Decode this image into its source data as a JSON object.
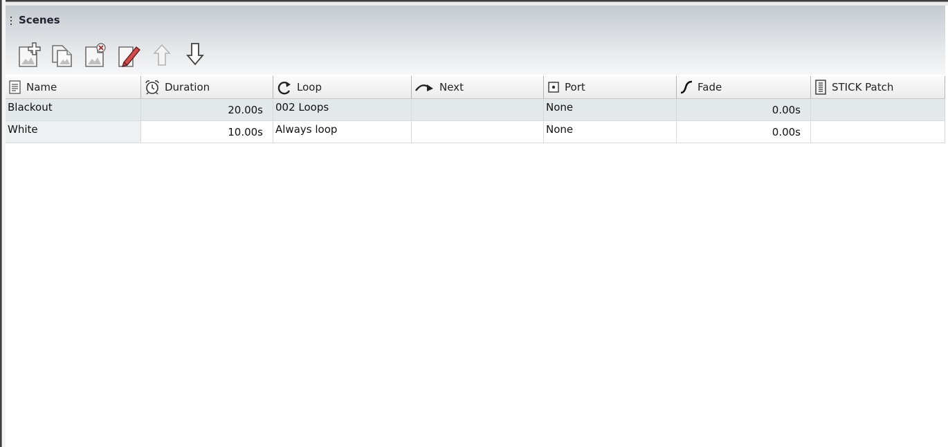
{
  "panel": {
    "title": "Scenes"
  },
  "toolbar": {
    "buttons": [
      {
        "icon": "new-scene-icon",
        "enabled": true
      },
      {
        "icon": "copy-scene-icon",
        "enabled": true
      },
      {
        "icon": "delete-scene-icon",
        "enabled": true
      },
      {
        "icon": "edit-scene-icon",
        "enabled": true
      },
      {
        "icon": "move-up-icon",
        "enabled": false
      },
      {
        "icon": "move-down-icon",
        "enabled": true
      }
    ]
  },
  "table": {
    "columns": [
      {
        "label": "Name",
        "icon": "document-icon"
      },
      {
        "label": "Duration",
        "icon": "alarm-clock-icon"
      },
      {
        "label": "Loop",
        "icon": "loop-arrow-icon"
      },
      {
        "label": "Next",
        "icon": "next-arrow-icon"
      },
      {
        "label": "Port",
        "icon": "port-icon"
      },
      {
        "label": "Fade",
        "icon": "fade-curve-icon"
      },
      {
        "label": "STICK Patch",
        "icon": "patch-icon"
      }
    ],
    "rows": [
      {
        "name": "Blackout",
        "duration": "20.00s",
        "loop": "002 Loops",
        "next": "",
        "port": "None",
        "fade": "0.00s",
        "stick_patch": "",
        "selected": true
      },
      {
        "name": "White",
        "duration": "10.00s",
        "loop": "Always loop",
        "next": "",
        "port": "None",
        "fade": "0.00s",
        "stick_patch": "",
        "selected": false
      }
    ]
  },
  "colors": {
    "header_gradient_top": "#c6cbd0",
    "selected_row": "#e3e8ea",
    "edit_pencil": "#c0392b"
  }
}
